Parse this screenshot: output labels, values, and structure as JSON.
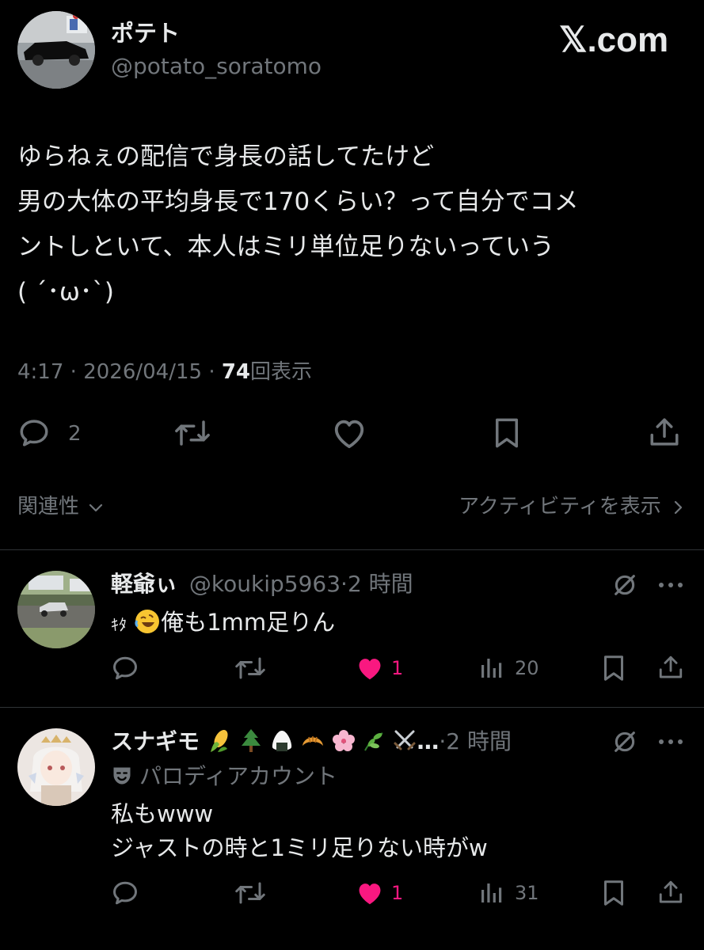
{
  "main_post": {
    "author_name": "ポテト",
    "author_handle": "@potato_soratomo",
    "watermark": "𝕏.com",
    "body_lines": [
      "ゆらねぇの配信で身長の話してたけど",
      "男の大体の平均身長で170くらい？って自分でコメ",
      "ントしといて、本人はミリ単位足りないっていう",
      "( ´･ω･`)"
    ],
    "time": "4:17",
    "sep1": "·",
    "date": "2026/04/15",
    "sep2": "·",
    "views_count": "74",
    "views_label": "回表示",
    "reply_count": "2"
  },
  "filter_bar": {
    "sort_label": "関連性",
    "activity_label": "アクティビティを表示"
  },
  "replies": [
    {
      "name": "軽爺ぃ",
      "handle": "@koukip5963",
      "sep": "·",
      "time": "2 時間",
      "text_prefix": "ｷﾀ",
      "text": "俺も1mm足りん",
      "like_count": "1",
      "views_count": "20"
    },
    {
      "name": "スナギモ",
      "name_suffix": "…",
      "sep": "·",
      "time": "2 時間",
      "badge_label": "パロディアカウント",
      "text_lines": [
        "私もwww",
        "ジャストの時と1ミリ足りない時がw"
      ],
      "like_count": "1",
      "views_count": "31"
    }
  ],
  "colors": {
    "background": "#000000",
    "text": "#e7e9ea",
    "muted": "#71767b",
    "like": "#f91880",
    "divider": "#2f3336"
  }
}
